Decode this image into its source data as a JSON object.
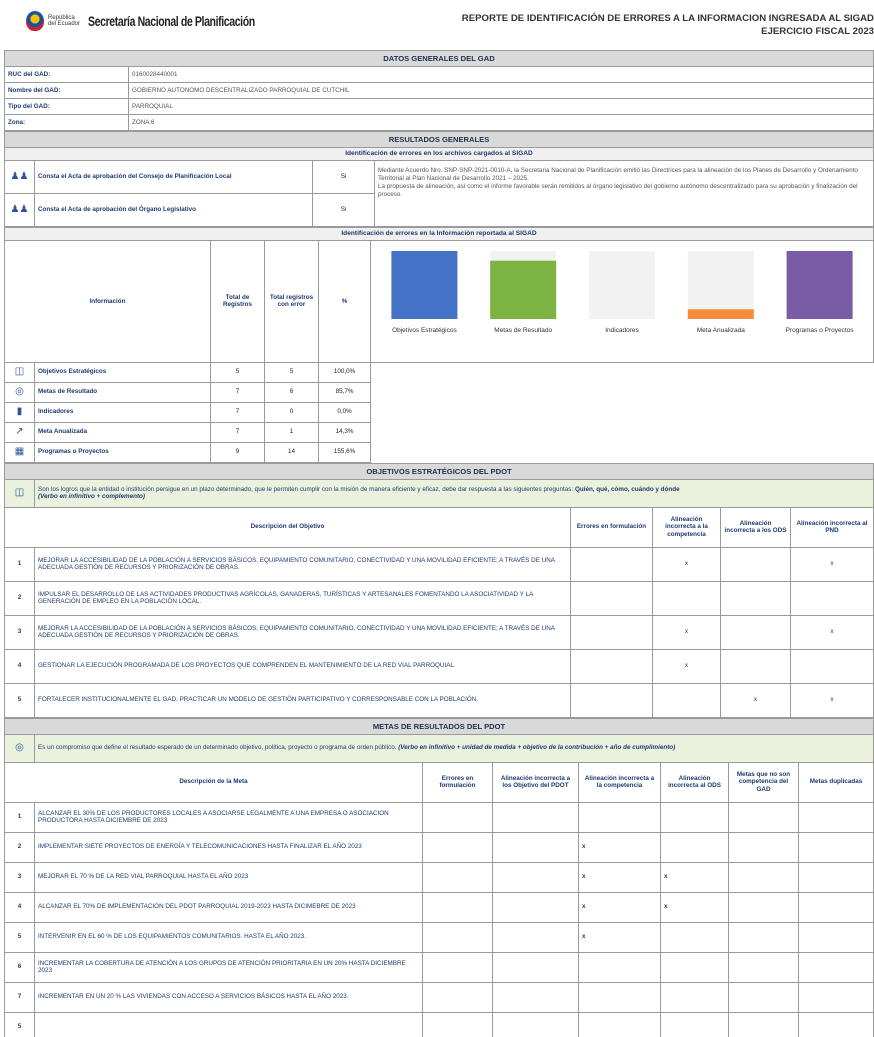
{
  "header": {
    "country_line1": "República",
    "country_line2": "del Ecuador",
    "org": "Secretaría Nacional de Planificación",
    "title_line1": "REPORTE DE IDENTIFICACIÓN DE ERRORES A LA INFORMACION INGRESADA AL SIGAD",
    "title_line2": "EJERCICIO FISCAL 2023"
  },
  "datos": {
    "title": "DATOS GENERALES DEL GAD",
    "rows": [
      {
        "label": "RUC del GAD:",
        "value": "0160028440001"
      },
      {
        "label": "Nombre del GAD:",
        "value": "GOBIERNO AUTONOMO DESCENTRALIZADO PARROQUIAL DE CUTCHIL"
      },
      {
        "label": "Tipo del GAD:",
        "value": "PARROQUIAL"
      },
      {
        "label": "Zona:",
        "value": "ZONA 6"
      }
    ]
  },
  "resultados": {
    "title": "RESULTADOS GENERALES",
    "archivos_title": "Identificación de errores en los archivos cargados al SIGAD",
    "acta1": "Consta el Acta de aprobación del Consejo de Planificación Local",
    "acta1_val": "Si",
    "acta2": "Consta el Acta de aprobación del Órgano Legislativo",
    "acta2_val": "Si",
    "note1": "Mediante Acuerdo Nro. SNP-SNP-2021-0010-A, la Secretaria Nacional de Planificación emitió las Directrices para la alineación de los Planes de Desarrollo y Ordenamiento Territorial al Plan Nacional de Desarrollo 2021 – 2025.",
    "note2": "La propuesta de alineación, así como el informe favorable serán remitidos al órgano legislativo del gobierno autónomo descentralizado para su aprobación y finalización del proceso.",
    "info_title": "Identificación de errores en la Información reportada al SIGAD",
    "col_info": "Información",
    "col_total": "Total de Registros",
    "col_err": "Total registros con error",
    "col_pct": "%",
    "rows": [
      {
        "icon": "target-doc-icon",
        "glyph": "◫",
        "name": "Objetivos Estratégicos",
        "total": "5",
        "err": "5",
        "pct": "100,0%"
      },
      {
        "icon": "target-icon",
        "glyph": "◎",
        "name": "Metas de Resultado",
        "total": "7",
        "err": "6",
        "pct": "85,7%"
      },
      {
        "icon": "bar-chart-icon",
        "glyph": "▮",
        "name": "Indicadores",
        "total": "7",
        "err": "0",
        "pct": "0,0%"
      },
      {
        "icon": "trend-icon",
        "glyph": "↗",
        "name": "Meta Anualizada",
        "total": "7",
        "err": "1",
        "pct": "14,3%"
      },
      {
        "icon": "project-icon",
        "glyph": "▦",
        "name": "Programas o Proyectos",
        "total": "9",
        "err": "14",
        "pct": "155,6%"
      }
    ]
  },
  "chart_data": {
    "type": "bar",
    "categories": [
      "Objetivos Estratégicos",
      "Metas de Resultado",
      "Indicadores",
      "Meta Anualizada",
      "Programas o Proyectos"
    ],
    "values": [
      100.0,
      85.7,
      0.0,
      14.3,
      155.6
    ],
    "colors": [
      "#4472c4",
      "#7cb342",
      "#a5a5a5",
      "#f58c3c",
      "#7a5ba6"
    ],
    "ylim": [
      0,
      100
    ],
    "grid": false,
    "legend": "none"
  },
  "objetivos": {
    "title": "OBJETIVOS ESTRATÉGICOS DEL PDOT",
    "intro_text": "Son los logros que la entidad o institución persigue en un plazo  determinado, que le permiten cumplir con la misión de manera eficiente y eficaz, debe dar respuesta a las siguientes preguntas: ",
    "intro_bold": "Quién, qué, cómo, cuándo y dónde",
    "intro_italic": "(Verbo en infinitivo + complemento)",
    "col_desc": "Descripción del Objetivo",
    "col_err": "Errores en formulación",
    "col_comp": "Alineación incorrecta a la competencia",
    "col_ods": "Alineación incorrecta a los ODS",
    "col_pnd": "Alineación incorrecta al PND",
    "rows": [
      {
        "n": "1",
        "desc": "MEJORAR LA ACCESIBILIDAD DE LA POBLACIÓN A SERVICIOS BÁSICOS, EQUIPAMIENTO COMUNITARIO, CONECTIVIDAD Y UNA MOVILIDAD EFICIENTE; A TRAVÉS DE UNA ADECUADA GESTIÓN DE RECURSOS Y PRIORIZACIÓN DE OBRAS.",
        "err": "",
        "comp": "x",
        "ods": "",
        "pnd": "x"
      },
      {
        "n": "2",
        "desc": "IMPULSAR EL DESARROLLO DE LAS ACTIVIDADES PRODUCTIVAS AGRÍCOLAS, GANADERAS, TURÍSTICAS  Y ARTESANALES FOMENTANDO LA ASOCIATIVIDAD Y LA GENERACIÓN DE EMPLEO EN LA POBLACIÓN LOCAL.",
        "err": "",
        "comp": "",
        "ods": "",
        "pnd": ""
      },
      {
        "n": "3",
        "desc": "MEJORAR LA ACCESIBILIDAD DE LA POBLACIÓN A SERVICIOS BÁSICOS, EQUIPAMIENTO COMUNITARIO, CONECTIVIDAD Y UNA MOVILIDAD EFICIENTE; A TRAVÉS DE UNA ADECUADA GESTIÓN DE RECURSOS Y PRIORIZACIÓN DE OBRAS.",
        "err": "",
        "comp": "x",
        "ods": "",
        "pnd": "x"
      },
      {
        "n": "4",
        "desc": "GESTIONAR LA EJECUCIÓN PROGRAMADA DE LOS PROYECTOS QUE COMPRENDEN EL MANTENIMIENTO DE LA RED VIAL PARROQUIAL.",
        "err": "",
        "comp": "x",
        "ods": "",
        "pnd": ""
      },
      {
        "n": "5",
        "desc": "FORTALECER INSTITUCIONALMENTE EL GAD, PRACTICAR UN MODELO DE GESTIÓN PARTICIPATIVO Y CORRESPONSABLE CON LA POBLACIÓN.",
        "err": "",
        "comp": "",
        "ods": "x",
        "pnd": "x"
      }
    ]
  },
  "metas": {
    "title": "METAS DE RESULTADOS DEL PDOT",
    "intro_text": "Es un compromiso que define el resultado esperado de un determinado  objetivo, política, proyecto o programa de orden público. ",
    "intro_italic": "(Verbo en infinitivo + unidad de medida + objetivo de la contribución + año de cumplimiento)",
    "col_desc": "Descripción de la Meta",
    "col_err": "Errores en formulación",
    "col_obj": "Alineación incorrecta a los Objetivo del PDOT",
    "col_comp": "Alineación incorrecta a la competencia",
    "col_ods": "Alineación incorrecta al ODS",
    "col_nocomp": "Metas que no son competencia del GAD",
    "col_dup": "Metas duplicadas",
    "rows": [
      {
        "n": "1",
        "desc": "ALCANZAR EL 30% DE LOS PRODUCTORES LOCALES A ASOCIARSE LEGALMENTE A UNA EMPRESA O ASOCIACION PRODUCTORA HASTA DICIEMBRE DE 2023",
        "err": "",
        "obj": "",
        "comp": "",
        "ods": "",
        "nocomp": "",
        "dup": ""
      },
      {
        "n": "2",
        "desc": "IMPLEMENTAR SIETE PROYECTOS DE ENERGÍA Y TELECOMUNICACIONES HASTA FINALIZAR EL AÑO 2023",
        "err": "",
        "obj": "",
        "comp": "x",
        "ods": "",
        "nocomp": "",
        "dup": ""
      },
      {
        "n": "3",
        "desc": "MEJORAR EL 70 % DE LA RED VIAL PARROQUIAL HASTA EL AÑO 2023",
        "err": "",
        "obj": "",
        "comp": "x",
        "ods": "x",
        "nocomp": "",
        "dup": ""
      },
      {
        "n": "4",
        "desc": "ALCANZAR EL 70% DE IMPLEMENTACION DEL PDOT PARROQUIAL 2019-2023 HASTA DICIMEBRE DE 2023",
        "err": "",
        "obj": "",
        "comp": "x",
        "ods": "x",
        "nocomp": "",
        "dup": ""
      },
      {
        "n": "5",
        "desc": "INTERVENIR EN EL 60 % DE LOS EQUIPAMIENTOS COMUNITARIOS. HASTA EL AÑO 2023.",
        "err": "",
        "obj": "",
        "comp": "x",
        "ods": "",
        "nocomp": "",
        "dup": ""
      },
      {
        "n": "6",
        "desc": "INCREMENTAR LA COBERTURA DE ATENCIÓN A LOS GRUPOS DE ATENCIÓN PRIORITARIA EN UN 20% HASTA DICIEMBRE 2023",
        "err": "",
        "obj": "",
        "comp": "",
        "ods": "",
        "nocomp": "",
        "dup": ""
      },
      {
        "n": "7",
        "desc": "INCREMENTAR EN UN 20 % LAS VIVIENDAS CON ACCESO A SERVICIOS BÁSICOS HASTA EL AÑO 2023.",
        "err": "",
        "obj": "",
        "comp": "",
        "ods": "",
        "nocomp": "",
        "dup": ""
      },
      {
        "n": "5",
        "desc": "",
        "err": "",
        "obj": "",
        "comp": "",
        "ods": "",
        "nocomp": "",
        "dup": ""
      }
    ]
  }
}
